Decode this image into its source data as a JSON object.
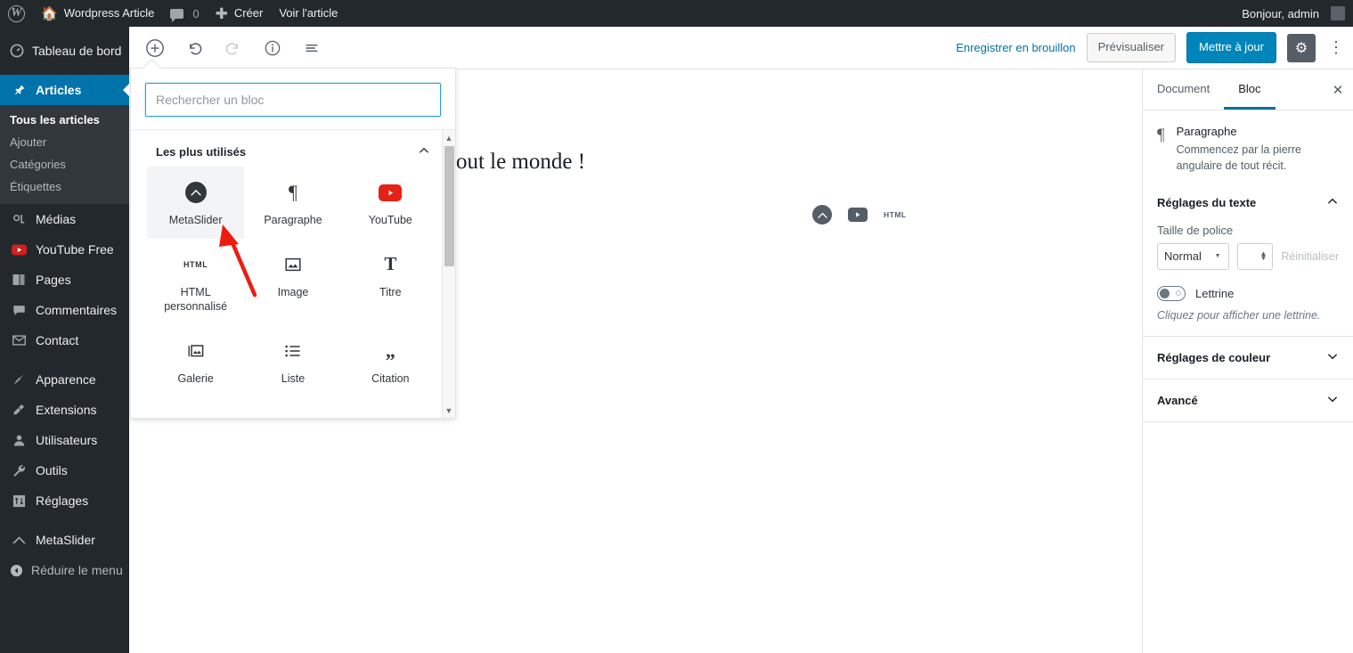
{
  "adminbar": {
    "logo_icon": "wordpress-logo-icon",
    "site_icon": "home-icon",
    "site_name": "Wordpress Article",
    "comments_icon": "comment-bubble-icon",
    "comments_count": "0",
    "new_icon": "plus-icon",
    "new_label": "Créer",
    "view_label": "Voir l'article",
    "greeting": "Bonjour, admin"
  },
  "adminmenu": {
    "items": [
      {
        "label": "Tableau de bord",
        "icon": "dashboard-icon",
        "current": false
      },
      {
        "label": "Articles",
        "icon": "pin-icon",
        "current": true
      }
    ],
    "submenu": [
      {
        "label": "Tous les articles",
        "current": true
      },
      {
        "label": "Ajouter",
        "current": false
      },
      {
        "label": "Catégories",
        "current": false
      },
      {
        "label": "Étiquettes",
        "current": false
      }
    ],
    "items2": [
      {
        "label": "Médias",
        "icon": "media-icon"
      },
      {
        "label": "YouTube Free",
        "icon": "youtube-icon"
      },
      {
        "label": "Pages",
        "icon": "pages-icon"
      },
      {
        "label": "Commentaires",
        "icon": "comment-icon"
      },
      {
        "label": "Contact",
        "icon": "envelope-icon"
      }
    ],
    "items3": [
      {
        "label": "Apparence",
        "icon": "paintbrush-icon"
      },
      {
        "label": "Extensions",
        "icon": "plug-icon"
      },
      {
        "label": "Utilisateurs",
        "icon": "user-icon"
      },
      {
        "label": "Outils",
        "icon": "wrench-icon"
      },
      {
        "label": "Réglages",
        "icon": "sliders-icon"
      }
    ],
    "items4": [
      {
        "label": "MetaSlider",
        "icon": "metaslider-icon"
      }
    ],
    "collapse": {
      "label": "Réduire le menu",
      "icon": "collapse-arrow-icon"
    }
  },
  "editor_header": {
    "tools": [
      {
        "name": "add-block-button",
        "icon": "plus-circle-icon",
        "disabled": false
      },
      {
        "name": "undo-button",
        "icon": "undo-arrow-icon",
        "disabled": false
      },
      {
        "name": "redo-button",
        "icon": "redo-arrow-icon",
        "disabled": true
      },
      {
        "name": "content-info-button",
        "icon": "info-circle-icon",
        "disabled": false
      },
      {
        "name": "block-navigation-button",
        "icon": "list-lines-icon",
        "disabled": false
      }
    ],
    "save_draft_label": "Enregistrer en brouillon",
    "preview_label": "Prévisualiser",
    "update_label": "Mettre à jour",
    "settings_icon": "gear-icon",
    "more_icon": "kebab-menu-icon"
  },
  "canvas": {
    "paragraph_text": "tout le monde !",
    "quick_inserts": [
      {
        "name": "metaslider-quick-insert",
        "icon": "metaslider-icon",
        "label": ""
      },
      {
        "name": "youtube-quick-insert",
        "icon": "youtube-play-icon",
        "label": ""
      },
      {
        "name": "html-quick-insert",
        "icon": "html-icon",
        "label": "HTML"
      }
    ]
  },
  "inserter": {
    "search_placeholder": "Rechercher un bloc",
    "search_value": "",
    "section_title": "Les plus utilisés",
    "section_collapse_icon": "chevron-up-icon",
    "blocks": [
      {
        "label": "MetaSlider",
        "icon": "metaslider-icon",
        "highlighted": true
      },
      {
        "label": "Paragraphe",
        "icon": "pilcrow-icon",
        "highlighted": false
      },
      {
        "label": "YouTube",
        "icon": "youtube-icon",
        "highlighted": false
      },
      {
        "label": "HTML personnalisé",
        "icon": "html-icon",
        "highlighted": false
      },
      {
        "label": "Image",
        "icon": "image-icon",
        "highlighted": false
      },
      {
        "label": "Titre",
        "icon": "heading-t-icon",
        "highlighted": false
      },
      {
        "label": "Galerie",
        "icon": "gallery-icon",
        "highlighted": false
      },
      {
        "label": "Liste",
        "icon": "list-icon",
        "highlighted": false
      },
      {
        "label": "Citation",
        "icon": "quote-icon",
        "highlighted": false
      }
    ],
    "scroll_up_icon": "scroll-up-arrow-icon",
    "scroll_down_icon": "scroll-down-arrow-icon"
  },
  "sidebar": {
    "tabs": [
      {
        "label": "Document",
        "active": false
      },
      {
        "label": "Bloc",
        "active": true
      }
    ],
    "close_icon": "close-x-icon",
    "block_card": {
      "icon": "pilcrow-icon",
      "title": "Paragraphe",
      "description": "Commencez par la pierre angulaire de tout récit."
    },
    "text_settings": {
      "title": "Réglages du texte",
      "collapse_icon": "chevron-up-icon",
      "font_size_label": "Taille de police",
      "font_size_value": "Normal",
      "font_size_dropdown_icon": "chevron-down-icon",
      "custom_size_value": "",
      "spinner_icon": "spinner-up-down-icon",
      "reset_label": "Réinitialiser",
      "dropcap_label": "Lettrine",
      "dropcap_state": "off",
      "dropcap_help": "Cliquez pour afficher une lettrine."
    },
    "sections": [
      {
        "title": "Réglages de couleur",
        "collapse_icon": "chevron-down-icon"
      },
      {
        "title": "Avancé",
        "collapse_icon": "chevron-down-icon"
      }
    ]
  },
  "annotation": {
    "arrow_color": "#ee1c10",
    "type": "arrow-pointing-to-metaslider-block"
  },
  "colors": {
    "admin_dark": "#23282d",
    "admin_submenu": "#32373c",
    "accent_blue": "#0073aa",
    "primary_button": "#0085ba",
    "link_blue": "#0073aa",
    "youtube_red": "#e62117"
  }
}
